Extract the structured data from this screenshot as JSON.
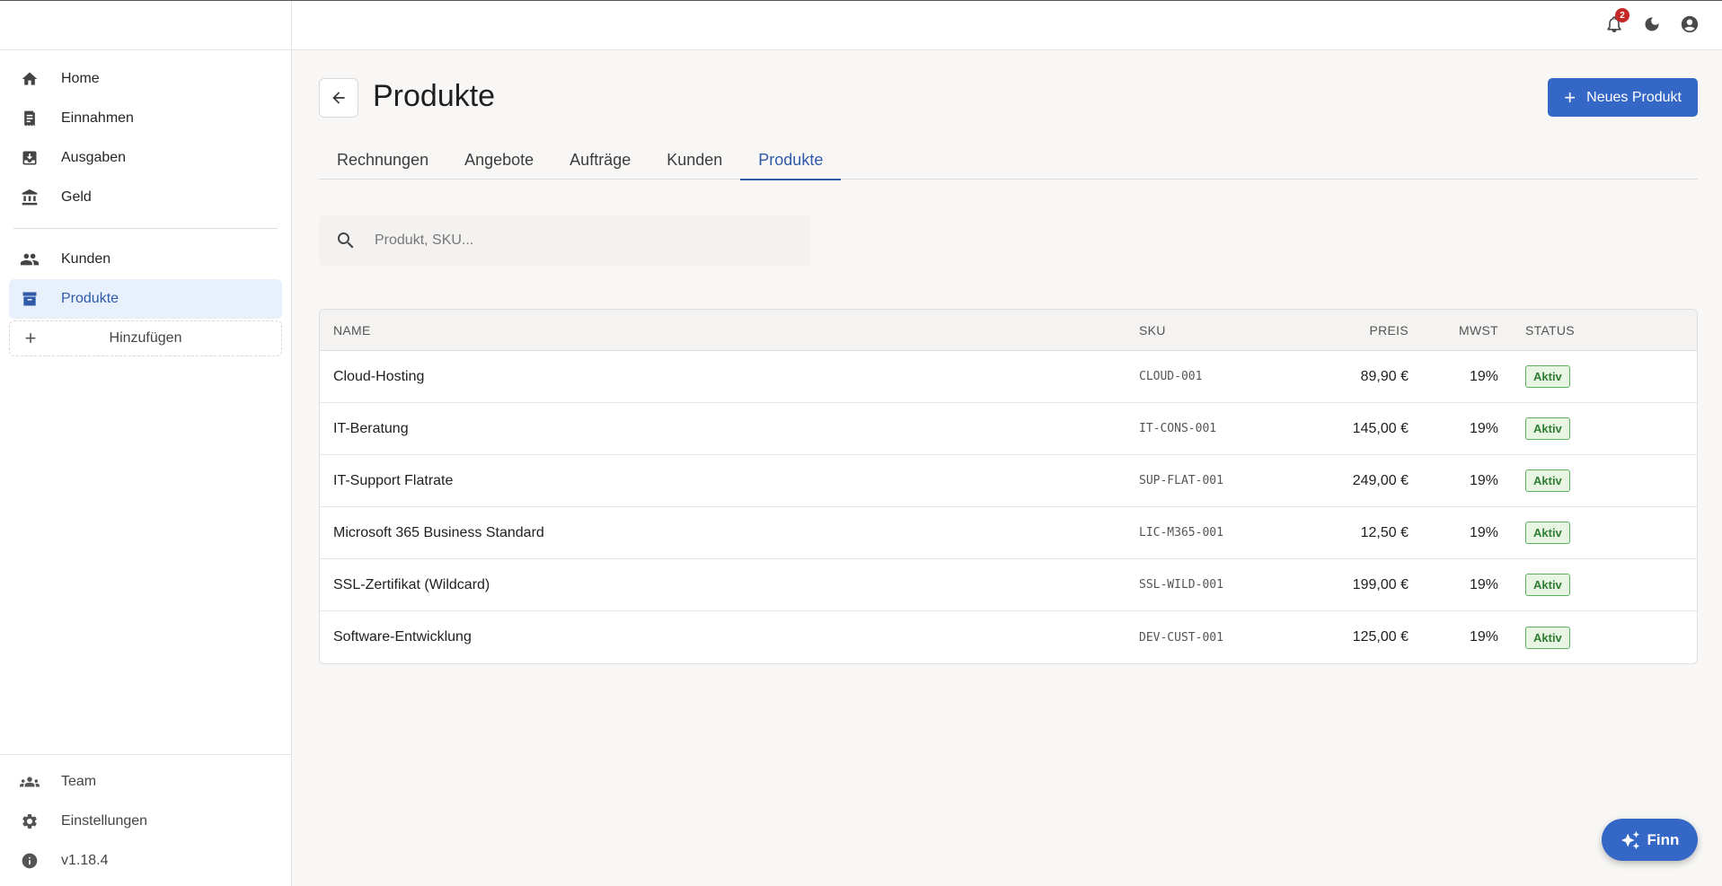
{
  "sidebar": {
    "nav": [
      {
        "label": "Home",
        "icon": "home-icon"
      },
      {
        "label": "Einnahmen",
        "icon": "receipt-icon"
      },
      {
        "label": "Ausgaben",
        "icon": "inbox-icon"
      },
      {
        "label": "Geld",
        "icon": "bank-icon"
      }
    ],
    "nav2": [
      {
        "label": "Kunden",
        "icon": "people-icon"
      },
      {
        "label": "Produkte",
        "icon": "archive-icon",
        "active": true
      }
    ],
    "add_label": "Hinzufügen",
    "bottom": [
      {
        "label": "Team",
        "icon": "groups-icon"
      },
      {
        "label": "Einstellungen",
        "icon": "gear-icon"
      },
      {
        "label": "v1.18.4",
        "icon": "info-icon"
      }
    ]
  },
  "topbar": {
    "notification_count": "2",
    "icons": [
      "bell-icon",
      "moon-icon",
      "account-icon"
    ]
  },
  "header": {
    "title": "Produkte",
    "new_button": "Neues Produkt"
  },
  "tabs": [
    {
      "label": "Rechnungen"
    },
    {
      "label": "Angebote"
    },
    {
      "label": "Aufträge"
    },
    {
      "label": "Kunden"
    },
    {
      "label": "Produkte",
      "active": true
    }
  ],
  "search": {
    "placeholder": "Produkt, SKU..."
  },
  "table": {
    "headers": {
      "name": "NAME",
      "sku": "SKU",
      "price": "PREIS",
      "vat": "MWST",
      "status": "STATUS"
    },
    "rows": [
      {
        "name": "Cloud-Hosting",
        "sku": "CLOUD-001",
        "price": "89,90 €",
        "vat": "19%",
        "status": "Aktiv"
      },
      {
        "name": "IT-Beratung",
        "sku": "IT-CONS-001",
        "price": "145,00 €",
        "vat": "19%",
        "status": "Aktiv"
      },
      {
        "name": "IT-Support Flatrate",
        "sku": "SUP-FLAT-001",
        "price": "249,00 €",
        "vat": "19%",
        "status": "Aktiv"
      },
      {
        "name": "Microsoft 365 Business Standard",
        "sku": "LIC-M365-001",
        "price": "12,50 €",
        "vat": "19%",
        "status": "Aktiv"
      },
      {
        "name": "SSL-Zertifikat (Wildcard)",
        "sku": "SSL-WILD-001",
        "price": "199,00 €",
        "vat": "19%",
        "status": "Aktiv"
      },
      {
        "name": "Software-Entwicklung",
        "sku": "DEV-CUST-001",
        "price": "125,00 €",
        "vat": "19%",
        "status": "Aktiv"
      }
    ]
  },
  "fab": {
    "label": "Finn",
    "icon": "sparkle-icon"
  },
  "colors": {
    "accent": "#3567c6",
    "active_nav_bg": "#e8f0fc",
    "status_green": "#2e7d32",
    "badge_red": "#c62828"
  }
}
